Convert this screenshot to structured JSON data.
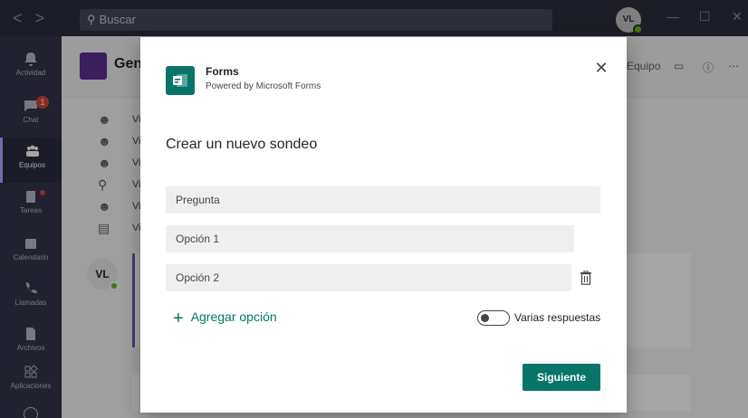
{
  "titlebar": {
    "search_placeholder": "Buscar",
    "user_initials": "VL",
    "window_controls": [
      "—",
      "☐",
      "✕"
    ]
  },
  "rail": {
    "items": [
      {
        "label": "Actividad",
        "icon": "bell-icon"
      },
      {
        "label": "Chat",
        "icon": "chat-icon",
        "badge": "1"
      },
      {
        "label": "Equipos",
        "icon": "teams-icon",
        "active": true
      },
      {
        "label": "Tareas",
        "icon": "tasks-icon"
      },
      {
        "label": "Calendario",
        "icon": "calendar-icon"
      },
      {
        "label": "Llamadas",
        "icon": "phone-icon"
      },
      {
        "label": "Archivos",
        "icon": "file-icon"
      },
      {
        "label": "Aplicaciones",
        "icon": "apps-icon"
      }
    ]
  },
  "background": {
    "team_name": "Gen",
    "header_right": "Equipo",
    "list_items": [
      "Vi",
      "Vi",
      "Vi",
      "Vi",
      "Vi",
      "Vi"
    ],
    "avatar_initials": "VL"
  },
  "dialog": {
    "app_name": "Forms",
    "app_subtitle": "Powered by Microsoft Forms",
    "title": "Crear un nuevo sondeo",
    "question_placeholder": "Pregunta",
    "option1_placeholder": "Opción 1",
    "option2_placeholder": "Opción 2",
    "add_option_label": "Agregar opción",
    "multiple_answers_label": "Varias respuestas",
    "multiple_answers_enabled": false,
    "next_label": "Siguiente",
    "accent_color": "#077568"
  }
}
